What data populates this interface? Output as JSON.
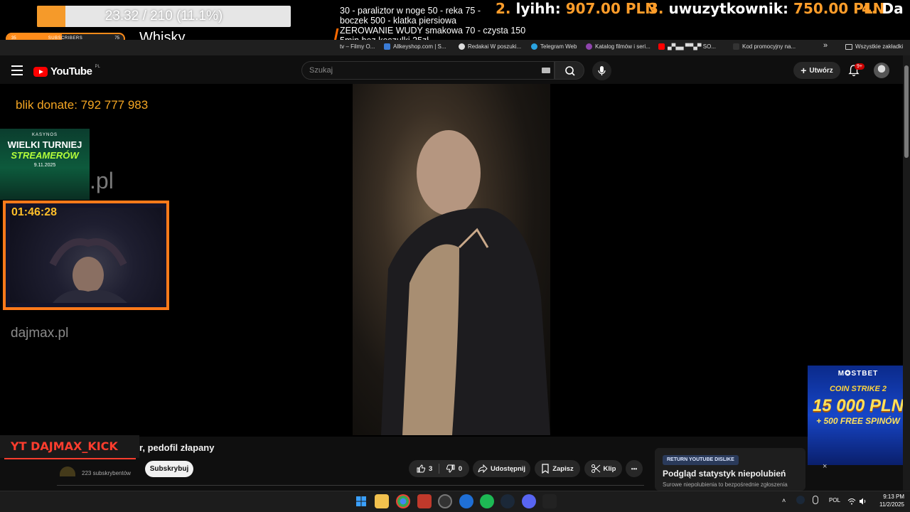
{
  "overlay": {
    "goal_text": "23.32 / 210 (11.1%)",
    "goal_percent": 11.1,
    "subs_left": "35",
    "subs_label": "SUBSCRIBERS",
    "subs_right": "75",
    "subs_fraction": 0.47,
    "drink_label": "Whisky",
    "price_lines": [
      "30 - paraliztor w noge 50 - reka 75 -",
      " boczek 500 - klatka piersiowa",
      "ZEROWANIE WUDY smakowa 70 - czysta 150",
      "5min bez koszulki 25zł"
    ],
    "leaderboard": [
      {
        "rank": "2.",
        "name": "lyihh:",
        "amount": "907.00 PLN"
      },
      {
        "rank": "3.",
        "name": "uwuzytkownik:",
        "amount": "750.00 PLN"
      },
      {
        "rank": "4.",
        "name": "Da",
        "amount": ""
      }
    ]
  },
  "bookmarks": [
    {
      "label": "tv – Filmy O...",
      "color": "#444444"
    },
    {
      "label": "Allkeyshop.com | S...",
      "color": "#3a7bd5"
    },
    {
      "label": "Redakai W poszuki...",
      "color": "#dddddd"
    },
    {
      "label": "Telegram Web",
      "color": "#2aa3e0"
    },
    {
      "label": "Katalog filmów i seri...",
      "color": "#8e44ad"
    },
    {
      "label": "▄▀▄▄ ▀▀▄▀ SO...",
      "color": "#ff0000"
    },
    {
      "label": "Kod promocyjny na...",
      "color": "#222222"
    }
  ],
  "bookmarks_more": "»",
  "bookmarks_all": "Wszystkie zakładki",
  "youtube": {
    "logo_text": "YouTube",
    "country": "PL",
    "search_placeholder": "Szukaj",
    "create_label": "Utwórz",
    "notifications_badge": "9+"
  },
  "stream": {
    "blik": "blik donate: 792 777 983",
    "casino": {
      "brand": "KASYNOS",
      "title1": "WIELKI TURNIEJ",
      "title2": "STREAMERÓW",
      "date": "9.11.2025"
    },
    "partial_site": "x.pl",
    "timer": "01:46:28",
    "site": "dajmax.pl",
    "kick_tag": "YT DAJMAX_KICK"
  },
  "mostbet": {
    "brand": "M✪STBET",
    "game": "COIN STRIKE 2",
    "amount": "15 000 PLN",
    "spins": "+ 500 FREE SPINÓW",
    "close": "×"
  },
  "video": {
    "title_partial": "r, pedofil złapany",
    "subs_partial": "223 subskrybentów",
    "subscribe_label": "Subskrybuj",
    "likes": "3",
    "dislikes": "0",
    "share_label": "Udostępnij",
    "save_label": "Zapisz",
    "clip_label": "Klip",
    "more_label": "•••"
  },
  "rtyd": {
    "badge": "RETURN YOUTUBE DISLIKE",
    "title": "Podgląd statystyk niepolubień",
    "subtitle": "Surowe niepolubienia to bezpośrednie zgłoszenia"
  },
  "taskbar": {
    "lang": "POL",
    "time": "9:13 PM",
    "date": "11/2/2025",
    "apps": [
      {
        "name": "start",
        "color": "#3aa0ff"
      },
      {
        "name": "explorer",
        "color": "#f2c14e"
      },
      {
        "name": "chrome",
        "color": "#34a853"
      },
      {
        "name": "voicemeeter",
        "color": "#c0392b"
      },
      {
        "name": "obs",
        "color": "#444444"
      },
      {
        "name": "ccleaner",
        "color": "#1f6fd6"
      },
      {
        "name": "spotify",
        "color": "#1db954"
      },
      {
        "name": "steam",
        "color": "#1b2838"
      },
      {
        "name": "discord",
        "color": "#5865f2"
      },
      {
        "name": "kick-app",
        "color": "#222222"
      }
    ]
  }
}
